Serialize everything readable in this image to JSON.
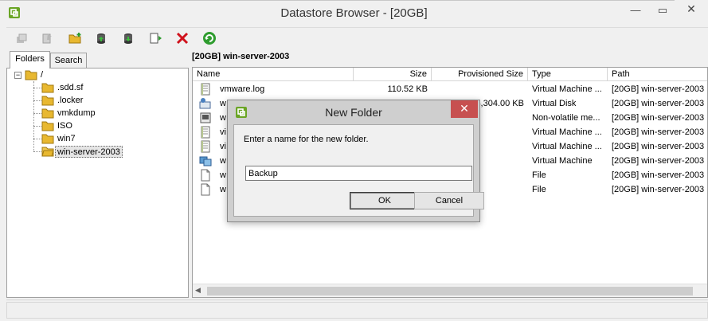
{
  "window": {
    "title": "Datastore Browser - [20GB]",
    "min_glyph": "—",
    "max_glyph": "▭",
    "close_glyph": "✕"
  },
  "toolbar": {
    "buttons": [
      {
        "name": "upload-icon",
        "enabled": false
      },
      {
        "name": "download-icon",
        "enabled": false
      },
      {
        "name": "new-folder-icon",
        "enabled": true
      },
      {
        "name": "upload-file-icon",
        "enabled": true
      },
      {
        "name": "download-file-icon",
        "enabled": true
      },
      {
        "name": "move-icon",
        "enabled": true
      },
      {
        "name": "delete-icon",
        "enabled": true
      },
      {
        "name": "refresh-icon",
        "enabled": true
      }
    ]
  },
  "tabs": {
    "folders": "Folders",
    "search": "Search"
  },
  "tree": {
    "root": "/",
    "expander": "−",
    "children": [
      ".sdd.sf",
      ".locker",
      "vmkdump",
      "ISO",
      "win7",
      "win-server-2003"
    ],
    "selected": "win-server-2003"
  },
  "content": {
    "header": "[20GB] win-server-2003",
    "columns": [
      "Name",
      "Size",
      "Provisioned Size",
      "Type",
      "Path"
    ],
    "rows": [
      {
        "icon": "log-file-icon",
        "name": "vmware.log",
        "size": "110.52 KB",
        "provisioned": "",
        "type": "Virtual Machine ...",
        "path": "[20GB] win-server-2003"
      },
      {
        "icon": "virtual-disk-icon",
        "name": "w",
        "size": "",
        "provisioned": "4,304.00 KB",
        "type": "Virtual Disk",
        "path": "[20GB] win-server-2003"
      },
      {
        "icon": "nvram-icon",
        "name": "w",
        "size": "",
        "provisioned": "",
        "type": "Non-volatile me...",
        "path": "[20GB] win-server-2003"
      },
      {
        "icon": "log-file-icon",
        "name": "vi",
        "size": "",
        "provisioned": "",
        "type": "Virtual Machine ...",
        "path": "[20GB] win-server-2003"
      },
      {
        "icon": "log-file-icon",
        "name": "vi",
        "size": "",
        "provisioned": "",
        "type": "Virtual Machine ...",
        "path": "[20GB] win-server-2003"
      },
      {
        "icon": "virtual-machine-icon",
        "name": "w",
        "size": "",
        "provisioned": "",
        "type": "Virtual Machine",
        "path": "[20GB] win-server-2003"
      },
      {
        "icon": "file-icon",
        "name": "w",
        "size": "",
        "provisioned": "",
        "type": "File",
        "path": "[20GB] win-server-2003"
      },
      {
        "icon": "file-icon",
        "name": "w",
        "size": "",
        "provisioned": "",
        "type": "File",
        "path": "[20GB] win-server-2003"
      }
    ]
  },
  "dialog": {
    "title": "New Folder",
    "close_glyph": "✕",
    "prompt": "Enter a name for the new folder.",
    "input_value": "Backup",
    "ok_label": "OK",
    "cancel_label": "Cancel"
  },
  "scroll_left_glyph": "◀",
  "colors": {
    "folder": "#e8b830",
    "close_red": "#c75050",
    "refresh_green": "#2e9c2e",
    "delete_red": "#d0121c"
  }
}
